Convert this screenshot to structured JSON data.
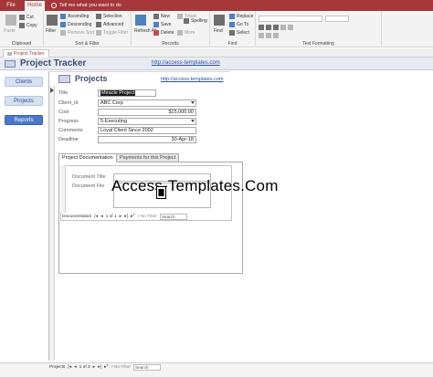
{
  "app": {
    "file_tab": "File",
    "home_tab": "Home",
    "tell_me": "Tell me what you want to do"
  },
  "ribbon": {
    "clipboard": {
      "label": "Clipboard",
      "paste": "Paste",
      "cut": "Cut",
      "copy": "Copy"
    },
    "sort_filter": {
      "label": "Sort & Filter",
      "filter": "Filter",
      "ascending": "Ascending",
      "descending": "Descending",
      "remove_sort": "Remove Sort",
      "selection": "Selection",
      "advanced": "Advanced",
      "toggle_filter": "Toggle Filter"
    },
    "records": {
      "label": "Records",
      "refresh_all": "Refresh All",
      "new": "New",
      "save": "Save",
      "delete": "Delete",
      "totals": "Totals",
      "spelling": "Spelling",
      "more": "More"
    },
    "find": {
      "label": "Find",
      "find": "Find",
      "replace": "Replace",
      "go_to": "Go To",
      "select": "Select"
    },
    "text_formatting": {
      "label": "Text Formatting"
    }
  },
  "object_tab": {
    "label": "Project Tracker"
  },
  "header": {
    "title": "Project Tracker",
    "link": "http://access-templates.com"
  },
  "nav": {
    "clients": "Clients",
    "projects": "Projects",
    "reports": "Reports"
  },
  "projects_form": {
    "title": "Projects",
    "link": "http://access-templates.com",
    "fields": {
      "title": {
        "label": "Title",
        "value": "Miracle Project"
      },
      "client_id": {
        "label": "Client_id",
        "value": "ABC Corp"
      },
      "cost": {
        "label": "Cost",
        "value": "$15,000.00"
      },
      "progress": {
        "label": "Progress",
        "value": "5-Executing"
      },
      "comments": {
        "label": "Comments",
        "value": "Loyal Client Since 2002"
      },
      "deadline": {
        "label": "Deadline",
        "value": "30-Apr-18"
      }
    },
    "tabs": [
      "Project Documentation",
      "Payments for this Project"
    ],
    "doc_subform": {
      "document_title_label": "Document Title",
      "document_file_label": "Document File",
      "nav": {
        "label": "Documentation",
        "record": "1 of 1",
        "filter": "No Filter",
        "search": "Search"
      }
    }
  },
  "main_nav": {
    "label": "Projects",
    "record": "1 of 3",
    "filter": "No Filter",
    "search": "Search"
  },
  "watermark": "Access-Templates.Com"
}
